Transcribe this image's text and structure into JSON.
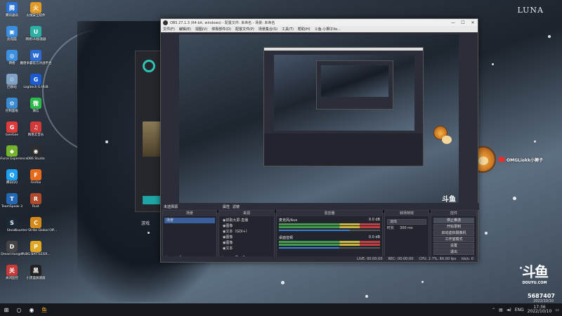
{
  "desktop": {
    "watermark_brand": "LUNA",
    "douyu_logo": "斗鱼",
    "douyu_url": "DOUYU.COM",
    "room_number": "5687407",
    "room_date": "2022/10/10",
    "lion_badge_text": "OMGLiokk小狮子",
    "icons": [
      {
        "label": "腾讯通讯",
        "color": "#2a73d9",
        "glyph": "腾"
      },
      {
        "label": "此电脑",
        "color": "#3b8fe0",
        "glyph": "▣"
      },
      {
        "label": "网络",
        "color": "#3b8fe0",
        "glyph": "◎"
      },
      {
        "label": "回收站",
        "color": "#7fa2c6",
        "glyph": "♲"
      },
      {
        "label": "控制面板",
        "color": "#3a8bd2",
        "glyph": "⚙"
      },
      {
        "label": "GeeGee",
        "color": "#e03a3a",
        "glyph": "G"
      },
      {
        "label": "GeForce Experience",
        "color": "#75b52b",
        "glyph": "◆"
      },
      {
        "label": "腾讯QQ",
        "color": "#1da1f2",
        "glyph": "Q"
      },
      {
        "label": "TeamSpeak 3",
        "color": "#2468b4",
        "glyph": "T"
      },
      {
        "label": "Steam",
        "color": "#1b2838",
        "glyph": "S"
      },
      {
        "label": "Dread Hunger",
        "color": "#444",
        "glyph": "D"
      },
      {
        "label": "关闭监控",
        "color": "#c73a3a",
        "glyph": "关"
      },
      {
        "label": "火绒安全软件",
        "color": "#e39b25",
        "glyph": "火"
      },
      {
        "label": "网易UU加速器",
        "color": "#2bb0a4",
        "glyph": "U"
      },
      {
        "label": "魔兽争霸官方对战平台",
        "color": "#2a6bd6",
        "glyph": "W"
      },
      {
        "label": "Logitech G HUB",
        "color": "#1a5bd1",
        "glyph": "G"
      },
      {
        "label": "微信",
        "color": "#2cba4a",
        "glyph": "微"
      },
      {
        "label": "网易云音乐",
        "color": "#d23a3a",
        "glyph": "♫"
      },
      {
        "label": "OBS Studio",
        "color": "#2d2d2d",
        "glyph": "◉"
      },
      {
        "label": "Firefox",
        "color": "#e66b1a",
        "glyph": "F"
      },
      {
        "label": "Rust",
        "color": "#b04a2a",
        "glyph": "R"
      },
      {
        "label": "Counter-Strike Global Off...",
        "color": "#d48a1a",
        "glyph": "C"
      },
      {
        "label": "PUBG BATTLEGR...",
        "color": "#e0a824",
        "glyph": "P"
      },
      {
        "label": "小黑盒加速器",
        "color": "#222",
        "glyph": "黑"
      }
    ]
  },
  "obs": {
    "title": "OBS 27.1.3 (64-bit, windows) - 配置文件: 未命名 - 场景: 未命名",
    "menu": [
      "文件(F)",
      "编辑(E)",
      "视图(V)",
      "停靠部件(D)",
      "配置文件(P)",
      "场景集合(S)",
      "工具(T)",
      "帮助(H)",
      "斗鱼-小狮子lio..."
    ],
    "scene_tab_label": "未选择源",
    "tab_properties": "属性",
    "tab_filters": "滤镜",
    "docks": {
      "scenes": {
        "title": "场景",
        "items": [
          "场景"
        ]
      },
      "sources": {
        "title": "来源",
        "items": [
          "抓取大屏-直播",
          "图像",
          "文本（GDI+）",
          "图像",
          "图像",
          "文本"
        ]
      },
      "mixer": {
        "title": "混音器",
        "channels": [
          {
            "name": "麦克风/Aux",
            "db": "0.0 dB",
            "level": 0.7
          },
          {
            "name": "桌面音频",
            "db": "0.0 dB",
            "level": 0.6
          }
        ]
      },
      "transitions": {
        "title": "转场特效",
        "type": "淡出",
        "duration_label": "时长",
        "duration": "300 ms"
      },
      "controls": {
        "title": "控件",
        "buttons": [
          "停止推流",
          "开始录制",
          "启动虚拟摄像机",
          "工作室模式",
          "设置",
          "退出"
        ]
      }
    },
    "status": {
      "live": "LIVE: 00:00:00",
      "rec": "REC: 00:00:00",
      "cpu": "CPU: 2.7%, 60.00 fps",
      "kbps": "kb/s: 0"
    }
  },
  "taskbar": {
    "items": [
      "windows-start",
      "cortana",
      "obs-app",
      "douyu-app"
    ],
    "lang": "ENG",
    "time": "17:36",
    "date": "2022/10/10"
  }
}
